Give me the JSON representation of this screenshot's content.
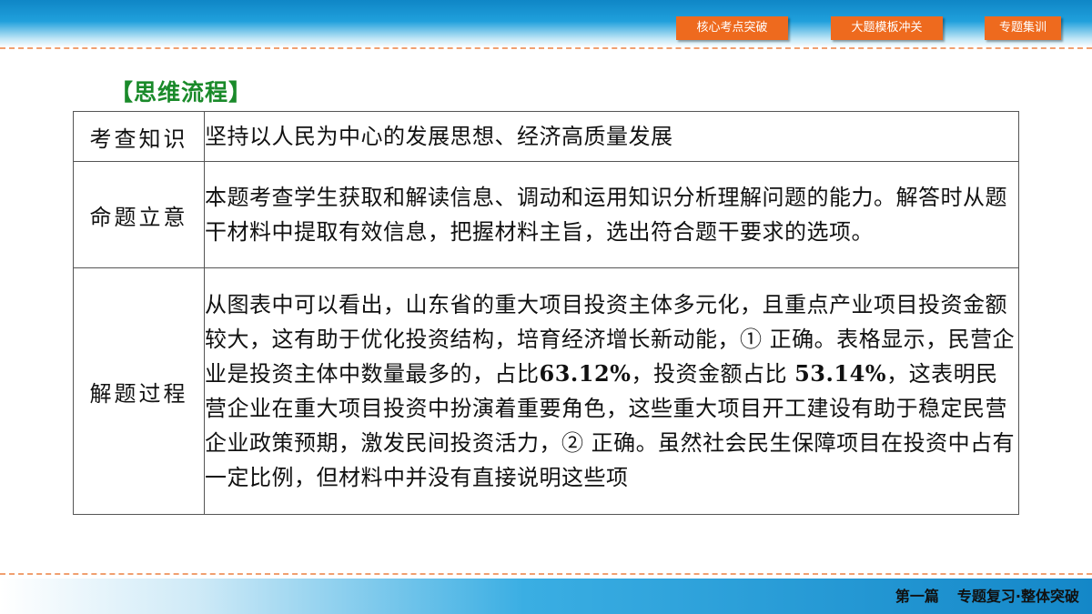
{
  "nav": {
    "items": [
      "核心考点突破",
      "大题模板冲关",
      "专题集训"
    ]
  },
  "section_title": "【思维流程】",
  "table": {
    "rows": [
      {
        "label": "考查知识",
        "content": "坚持以人民为中心的发展思想、经济高质量发展"
      },
      {
        "label": "命题立意",
        "content": "本题考查学生获取和解读信息、调动和运用知识分析理解问题的能力。解答时从题干材料中提取有效信息，把握材料主旨，选出符合题干要求的选项。"
      },
      {
        "label": "解题过程",
        "content_parts": [
          "从图表中可以看出，山东省的重大项目投资主体多元化，且重点产业项目投资金额较大，这有助于优化投资结构，培育经济增长新动能，",
          "①",
          " 正确。表格显示，民营企业是投资主体中数量最多的，占比",
          "63.12%",
          "，投资金额占比 ",
          "53.14%",
          "，这表明民营企业在重大项目投资中扮演着重要角色，这些重大项目开工建设有助于稳定民营企业政策预期，激发民间投资活力，",
          "②",
          " 正确。虽然社会民生保障项目在投资中占有一定比例，但材料中并没有直接说明这些项"
        ]
      }
    ]
  },
  "footer": {
    "part": "第一篇",
    "title": "专题复习·整体突破"
  },
  "colors": {
    "nav_button": "#ee6a1e",
    "section_title": "#1a8a2a",
    "banner_blue": "#1487c8",
    "dash_line": "#f0a070"
  }
}
